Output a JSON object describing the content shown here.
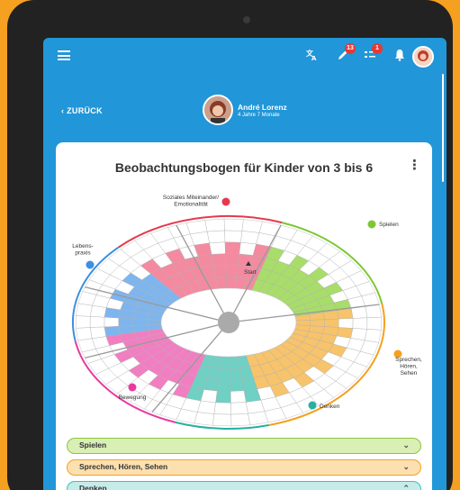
{
  "header": {
    "menu_icon": "menu-icon",
    "translate_icon": "translate-icon",
    "pencil_badge": "13",
    "checklist_badge": "1",
    "bell_icon": "bell-icon"
  },
  "nav": {
    "back_label": "ZURÜCK"
  },
  "child": {
    "name": "André Lorenz",
    "age": "4 Jahre 7 Monate"
  },
  "card": {
    "title": "Beobachtungsbogen für Kinder von 3 bis 6",
    "start_label": "Start",
    "legend": [
      {
        "key": "sozial",
        "label": "Soziales Miteinander/\nEmotionalität",
        "color": "#e53950"
      },
      {
        "key": "spielen",
        "label": "Spielen",
        "color": "#7cc832"
      },
      {
        "key": "lebenspraxis",
        "label": "Lebens-\npraxis",
        "color": "#3d8fe0"
      },
      {
        "key": "sprechen",
        "label": "Sprechen,\nHören,\nSehen",
        "color": "#f5a020"
      },
      {
        "key": "bewegung",
        "label": "Bewegung",
        "color": "#e83aa0"
      },
      {
        "key": "denken",
        "label": "Denken",
        "color": "#27b0a0"
      }
    ]
  },
  "accordions": [
    {
      "label": "Spielen",
      "bg": "#d9efb5",
      "border": "#8cc63f",
      "icon": "chevron-down-icon"
    },
    {
      "label": "Sprechen, Hören, Sehen",
      "bg": "#fde0b0",
      "border": "#f5a020",
      "icon": "chevron-down-icon"
    },
    {
      "label": "Denken",
      "bg": "#c6ecea",
      "border": "#3fc0b3",
      "icon": "chevron-up-icon"
    }
  ]
}
